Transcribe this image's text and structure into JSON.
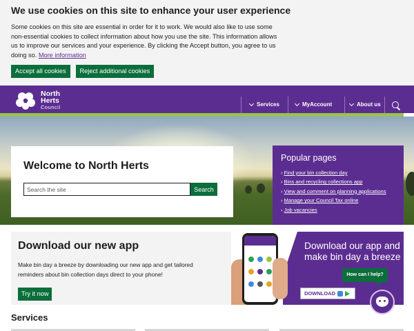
{
  "cookie_banner": {
    "title": "We use cookies on this site to enhance your user experience",
    "body": "Some cookies on this site are essential in order for it to work. We would also like to use some non-essential cookies to collect information about how you use the site. This information allows us to improve our services and your experience. By clicking the Accept button, you agree to us doing so.",
    "more_info_link": "More information",
    "accept_label": "Accept all cookies",
    "reject_label": "Reject additional cookies"
  },
  "header": {
    "logo_line1": "North",
    "logo_line2": "Herts",
    "logo_line3": "Council",
    "nav": [
      "Services",
      "MyAccount",
      "About us"
    ],
    "search_icon": "search-icon"
  },
  "hero": {
    "welcome_title": "Welcome to North Herts",
    "search_placeholder": "Search the site",
    "search_button": "Search"
  },
  "popular_pages": {
    "title": "Popular pages",
    "links": [
      "Find your bin collection day",
      "Bins and recycling collections app",
      "View and comment on planning applications",
      "Manage your Council Tax online",
      "Job vacancies"
    ]
  },
  "app_section": {
    "title": "Download our new app",
    "body": "Make bin day a breeze by downloading our new app and get tailored reminders about bin collection days direct to your phone!",
    "button": "Try it now",
    "promo_text": "Download our app and make bin day a breeze",
    "download_label": "DOWNLOAD"
  },
  "chat": {
    "prompt": "How can I help?"
  },
  "services": {
    "title": "Services"
  },
  "colors": {
    "brand_purple": "#5c2d91",
    "brand_green": "#0b6e3b",
    "accent_lime": "#9bc24b"
  }
}
